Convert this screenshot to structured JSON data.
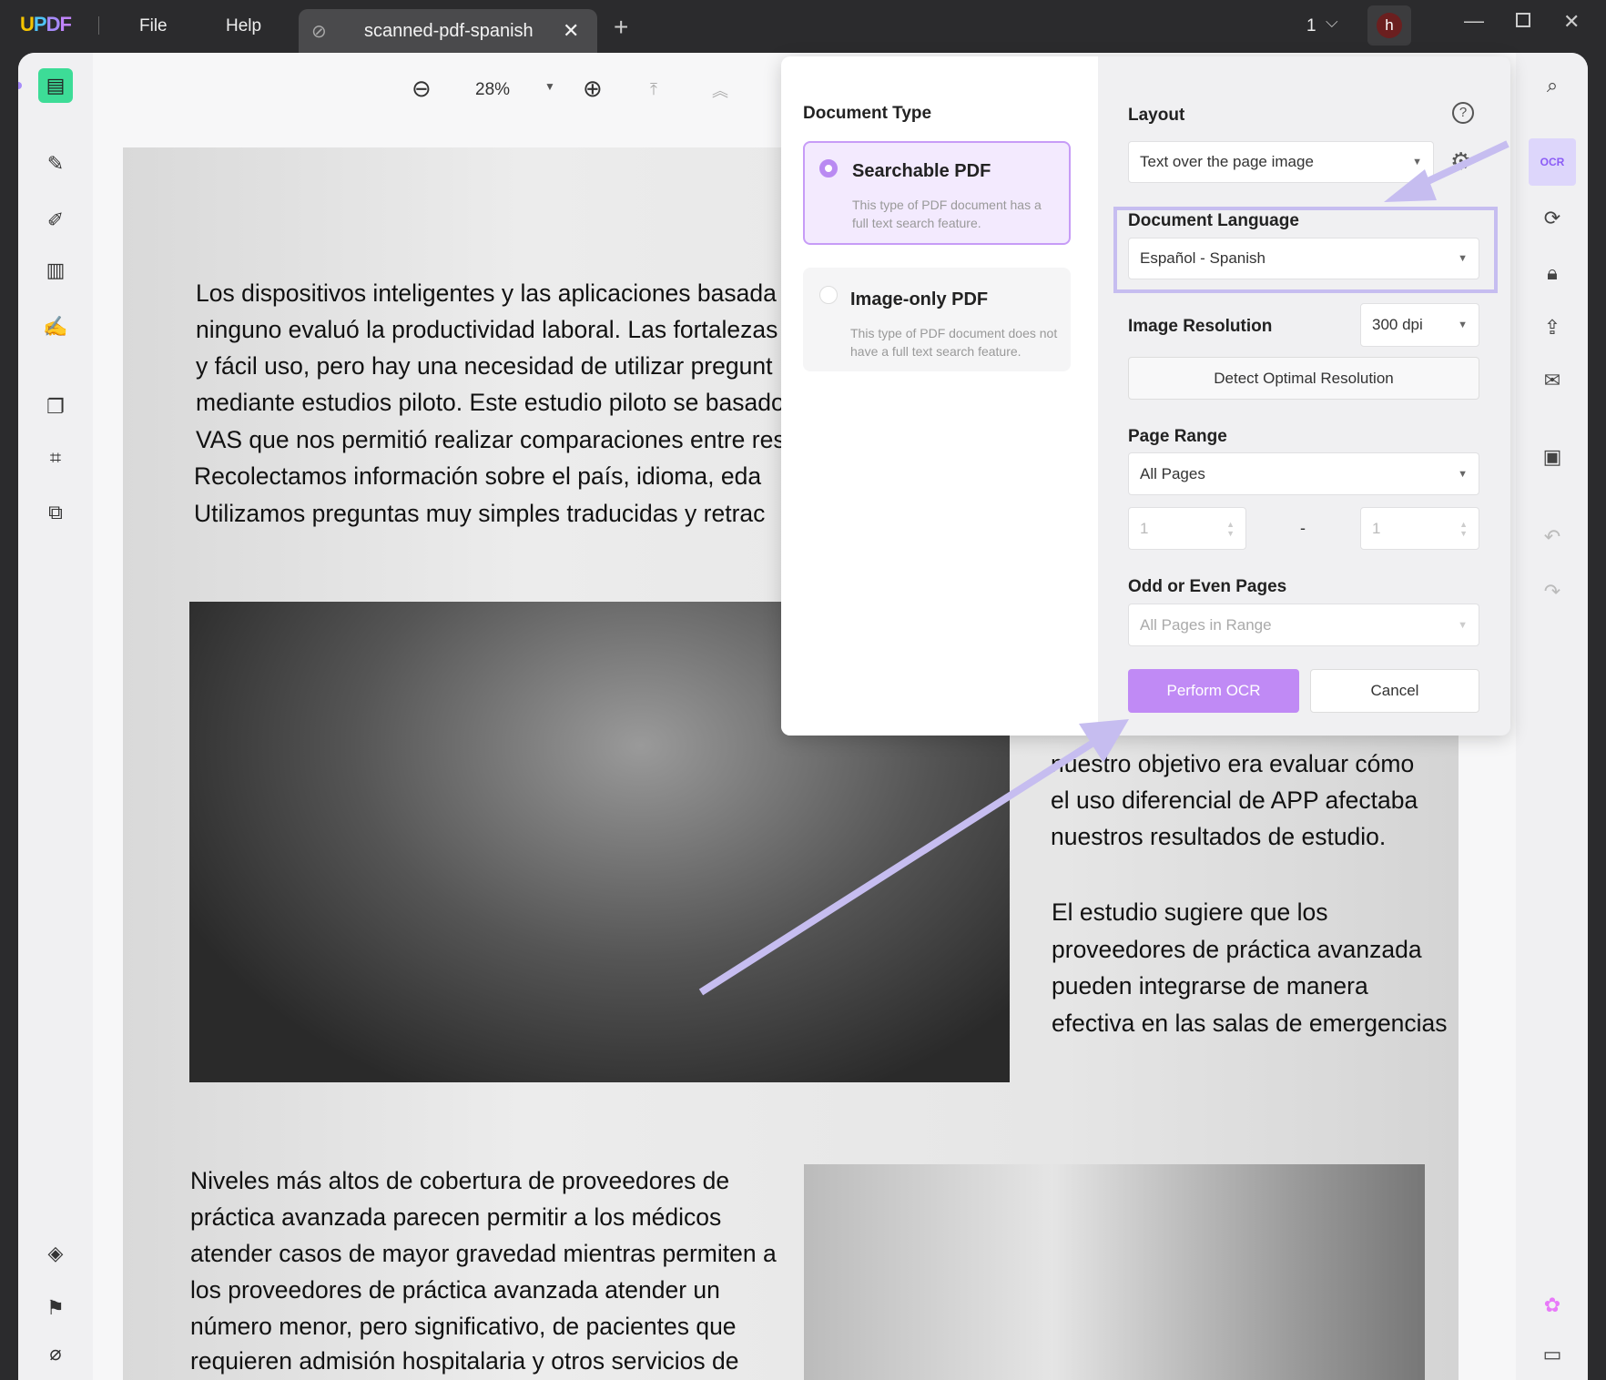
{
  "titlebar": {
    "logo": "UPDF",
    "menu": [
      "File",
      "Help"
    ],
    "tab_title": "scanned-pdf-spanish",
    "page_count": "1",
    "avatar": "h"
  },
  "toolbar": {
    "zoom": "28%"
  },
  "document": {
    "paragraph1": [
      "Los dispositivos inteligentes y las aplicaciones basada",
      "ninguno evaluó la productividad laboral. Las fortalezas",
      " y fácil uso, pero hay una necesidad de utilizar pregunt",
      "mediante estudios piloto. Este estudio piloto se basado",
      "VAS que nos permitió realizar comparaciones entre res",
      "Recolectamos información sobre el país, idioma, eda",
      "Utilizamos preguntas muy simples traducidas y retrac"
    ],
    "paragraph2": [
      " nuestro objetivo era evaluar cómo",
      "el uso diferencial de APP afectaba",
      "nuestros resultados de estudio."
    ],
    "paragraph3": [
      "El estudio sugiere que los",
      "proveedores de práctica avanzada",
      "pueden integrarse de manera",
      "efectiva en las salas de emergencias"
    ],
    "paragraph4": [
      "Niveles más altos de cobertura de proveedores de",
      "práctica avanzada parecen permitir a los médicos",
      "atender casos de mayor gravedad mientras permiten a",
      "los proveedores de práctica avanzada atender un",
      "número menor, pero significativo, de pacientes que",
      "requieren admisión hospitalaria y otros servicios de"
    ]
  },
  "ocr": {
    "doc_type_title": "Document Type",
    "searchable": {
      "label": "Searchable PDF",
      "desc": "This type of PDF document has a full text search feature.",
      "selected": true
    },
    "image_only": {
      "label": "Image-only PDF",
      "desc": "This type of PDF document does not have a full text search feature.",
      "selected": false
    },
    "layout_label": "Layout",
    "layout_value": "Text over the page image",
    "language_label": "Document Language",
    "language_value": "Español - Spanish",
    "resolution_label": "Image Resolution",
    "resolution_value": "300 dpi",
    "detect_button": "Detect Optimal Resolution",
    "page_range_label": "Page Range",
    "page_range_value": "All Pages",
    "range_from": "1",
    "range_sep": "-",
    "range_to": "1",
    "odd_even_label": "Odd or Even Pages",
    "odd_even_value": "All Pages in Range",
    "perform_button": "Perform OCR",
    "cancel_button": "Cancel"
  },
  "colors": {
    "accent": "#c08af5",
    "highlight": "#c6bdf0"
  }
}
